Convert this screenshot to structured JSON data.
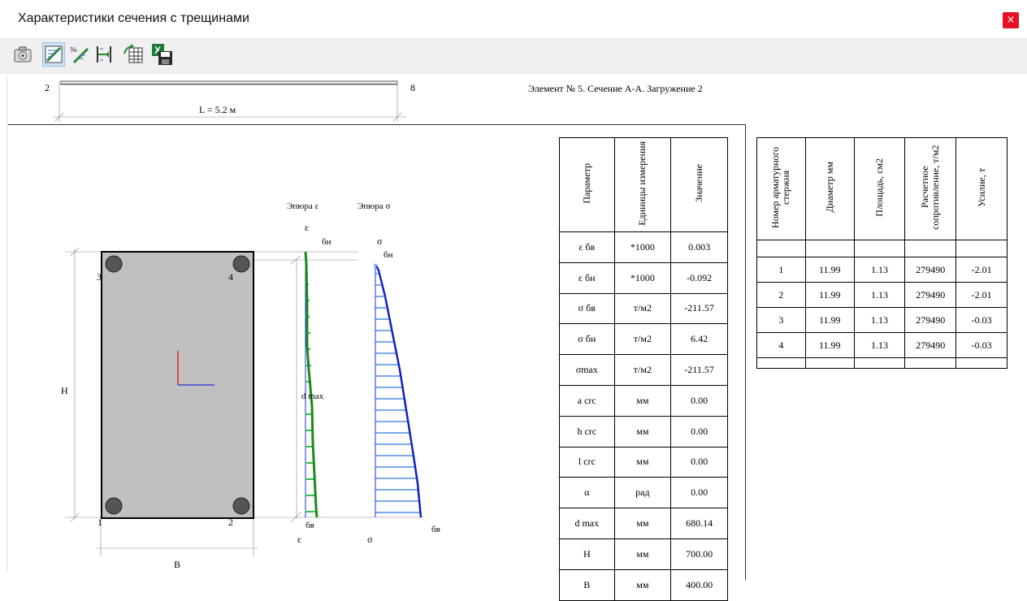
{
  "window": {
    "title": "Характеристики сечения с трещинами",
    "close_label": "×"
  },
  "toolbar": {
    "buttons": [
      {
        "name": "camera-icon",
        "active": false
      },
      {
        "name": "crack-section-icon",
        "active": true
      },
      {
        "name": "numbered-crack-icon",
        "active": false
      },
      {
        "name": "section-width-icon",
        "active": false
      },
      {
        "name": "grid-export-icon",
        "active": false
      },
      {
        "name": "excel-save-icon",
        "active": false
      }
    ]
  },
  "element_scheme": {
    "start_node": "2",
    "end_node": "8",
    "length_label": "L = 5.2 м"
  },
  "header_caption": "Элемент № 5. Сечение А-А. Загружение 2",
  "section": {
    "height_label": "H",
    "width_label": "B",
    "bars": [
      "3",
      "4",
      "1",
      "2"
    ]
  },
  "diagrams": {
    "strain_title": "Эпюра ε",
    "stress_title": "Эпюра σ",
    "strain_axis_top": "ε",
    "strain_axis_bottom": "ε",
    "stress_axis_top": "σ",
    "stress_axis_bottom": "σ",
    "top_fiber_label": "бн",
    "bottom_fiber_label": "бв",
    "dmax_label": "d max"
  },
  "params_table": {
    "headers": [
      "Параметр",
      "Единицы измерения",
      "Значение"
    ],
    "rows": [
      {
        "param": "ε бв",
        "unit": "*1000",
        "value": "0.003"
      },
      {
        "param": "ε бн",
        "unit": "*1000",
        "value": "-0.092"
      },
      {
        "param": "σ бв",
        "unit": "т/м2",
        "value": "-211.57"
      },
      {
        "param": "σ бн",
        "unit": "т/м2",
        "value": "6.42"
      },
      {
        "param": "σmax",
        "unit": "т/м2",
        "value": "-211.57"
      },
      {
        "param": "a crc",
        "unit": "мм",
        "value": "0.00"
      },
      {
        "param": "h crc",
        "unit": "мм",
        "value": "0.00"
      },
      {
        "param": "l crc",
        "unit": "мм",
        "value": "0.00"
      },
      {
        "param": "α",
        "unit": "рад",
        "value": "0.00"
      },
      {
        "param": "d max",
        "unit": "мм",
        "value": "680.14"
      },
      {
        "param": "H",
        "unit": "мм",
        "value": "700.00"
      },
      {
        "param": "B",
        "unit": "мм",
        "value": "400.00"
      }
    ]
  },
  "rebar_table": {
    "headers": [
      "Номер арматурного стержня",
      "Диаметр мм",
      "Площадь, см2",
      "Расчетное сопротивление, т/м2",
      "Усилие, т"
    ],
    "rows": [
      {
        "num": "1",
        "diameter": "11.99",
        "area": "1.13",
        "resistance": "279490",
        "force": "-2.01"
      },
      {
        "num": "2",
        "diameter": "11.99",
        "area": "1.13",
        "resistance": "279490",
        "force": "-2.01"
      },
      {
        "num": "3",
        "diameter": "11.99",
        "area": "1.13",
        "resistance": "279490",
        "force": "-0.03"
      },
      {
        "num": "4",
        "diameter": "11.99",
        "area": "1.13",
        "resistance": "279490",
        "force": "-0.03"
      }
    ]
  }
}
